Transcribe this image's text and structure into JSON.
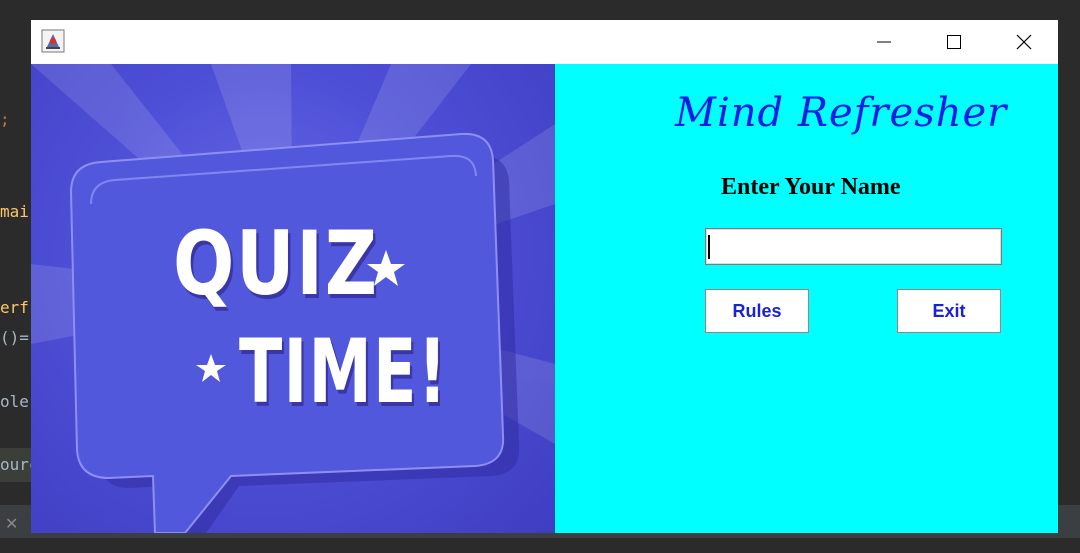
{
  "ide_background": {
    "fragments": [
      ";",
      "mai",
      "erf",
      "()=",
      "ole",
      "ourc"
    ]
  },
  "window": {
    "controls": {
      "minimize": "minimize-icon",
      "maximize": "maximize-icon",
      "close": "close-icon"
    }
  },
  "banner": {
    "line1": "QUIZ",
    "line2": "TIME!"
  },
  "form": {
    "title": "Mind Refresher",
    "name_label": "Enter Your Name",
    "name_value": "",
    "rules_label": "Rules",
    "exit_label": "Exit"
  },
  "colors": {
    "panel_bg": "#00ffff",
    "title_color": "#0a1ce8",
    "button_text": "#1a22d6",
    "banner_bg": "#4d4fd6"
  }
}
